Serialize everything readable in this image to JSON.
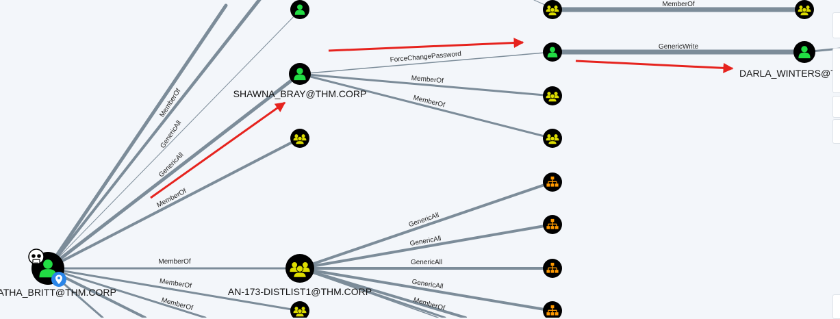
{
  "colors": {
    "background": "#f3f6fa",
    "edge": "#7c8c99",
    "node_fill": "#000000",
    "user_icon": "#22dd44",
    "group_icon": "#dddd00",
    "ou_icon": "#ff9900",
    "annotation_arrow": "#e6231e",
    "marker": "#2a85e8"
  },
  "nodes": {
    "tabatha": {
      "label": "TABATHA_BRITT@THM.CORP",
      "type": "user",
      "icon": "user-icon",
      "badges": [
        "skull-icon",
        "location-pin-icon"
      ]
    },
    "shawna": {
      "label": "SHAWNA_BRAY@THM.CORP",
      "type": "user",
      "icon": "user-icon"
    },
    "distlist": {
      "label": "AN-173-DISTLIST1@THM.CORP",
      "type": "group",
      "icon": "group-icon"
    },
    "darla": {
      "label": "DARLA_WINTERS@THM.CORP",
      "type": "user",
      "icon": "user-icon"
    },
    "user_top": {
      "label": "",
      "type": "user",
      "icon": "user-icon"
    },
    "group_mid": {
      "label": "",
      "type": "group",
      "icon": "group-icon"
    },
    "group_bottom": {
      "label": "",
      "type": "group",
      "icon": "group-icon"
    },
    "group_top_right": {
      "label": "",
      "type": "group",
      "icon": "group-icon"
    },
    "group_far_right": {
      "label": "",
      "type": "group",
      "icon": "group-icon"
    },
    "user_target": {
      "label": "",
      "type": "user",
      "icon": "user-icon"
    },
    "group_s1": {
      "label": "",
      "type": "group",
      "icon": "group-icon"
    },
    "group_s2": {
      "label": "",
      "type": "group",
      "icon": "group-icon"
    },
    "ou1": {
      "label": "",
      "type": "ou",
      "icon": "ou-icon"
    },
    "ou2": {
      "label": "",
      "type": "ou",
      "icon": "ou-icon"
    },
    "ou3": {
      "label": "",
      "type": "ou",
      "icon": "ou-icon"
    },
    "ou4": {
      "label": "",
      "type": "ou",
      "icon": "ou-icon"
    }
  },
  "edges": {
    "t_up": {
      "label": "MemberOf"
    },
    "t_ga1": {
      "label": "GenericAll"
    },
    "t_ga2": {
      "label": "GenericAll"
    },
    "t_mo_mid": {
      "label": "MemberOf"
    },
    "t_dist": {
      "label": "MemberOf"
    },
    "t_mo_b1": {
      "label": "MemberOf"
    },
    "t_mo_b2": {
      "label": "MemberOf"
    },
    "s_fcp": {
      "label": "ForceChangePassword"
    },
    "s_mo1": {
      "label": "MemberOf"
    },
    "s_mo2": {
      "label": "MemberOf"
    },
    "g_top": {
      "label": "MemberOf"
    },
    "gw": {
      "label": "GenericWrite"
    },
    "d_ga1": {
      "label": "GenericAll"
    },
    "d_ga2": {
      "label": "GenericAll"
    },
    "d_ga3": {
      "label": "GenericAll"
    },
    "d_ga4": {
      "label": "GenericAll"
    },
    "d_mo": {
      "label": "MemberOf"
    }
  }
}
